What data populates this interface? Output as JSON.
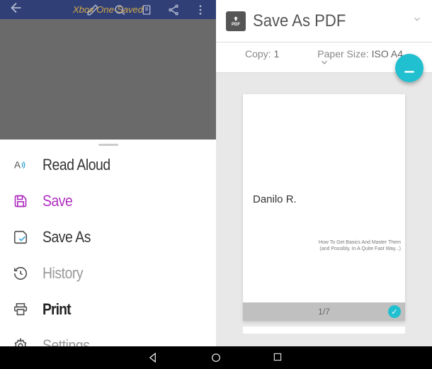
{
  "left": {
    "title": "Xbox One-Saved",
    "menu": {
      "read_aloud": "Read Aloud",
      "save": "Save",
      "save_as": "Save As",
      "history": "History",
      "print": "Print",
      "settings": "Settings"
    }
  },
  "right": {
    "header_title": "Save As PDF",
    "copy_label": "Copy:",
    "copy_value": "1",
    "paper_label": "Paper Size:",
    "paper_value": "ISO A4",
    "fab_label": "PDF",
    "preview": {
      "author": "Danilo R.",
      "subtitle_line1": "How To Get Basics And Master Them",
      "subtitle_line2": "(and Possibly, In A Quite Fast Way...)",
      "page_indicator": "1/7"
    }
  }
}
